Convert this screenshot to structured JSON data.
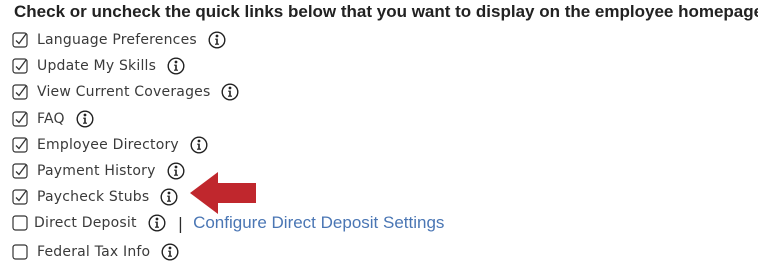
{
  "heading": "Check or uncheck the quick links below that you want to display on the employee homepage.",
  "items": [
    {
      "label": "Language Preferences",
      "checked": true
    },
    {
      "label": "Update My Skills",
      "checked": true
    },
    {
      "label": "View Current Coverages",
      "checked": true
    },
    {
      "label": "FAQ",
      "checked": true
    },
    {
      "label": "Employee Directory",
      "checked": true
    },
    {
      "label": "Payment History",
      "checked": true
    },
    {
      "label": "Paycheck Stubs",
      "checked": true
    },
    {
      "label": "Direct Deposit",
      "checked": false
    },
    {
      "label": "Federal Tax Info",
      "checked": false
    }
  ],
  "direct_deposit_link": "Configure Direct Deposit Settings",
  "separator": "|",
  "icons": {
    "info": "info-icon",
    "checkbox_checked": "checkbox-checked-icon",
    "checkbox_unchecked": "checkbox-unchecked-icon",
    "annotation_arrow": "red-arrow-icon"
  },
  "colors": {
    "link": "#4a76b4",
    "arrow": "#c0272d",
    "text": "#3a3a3a"
  }
}
